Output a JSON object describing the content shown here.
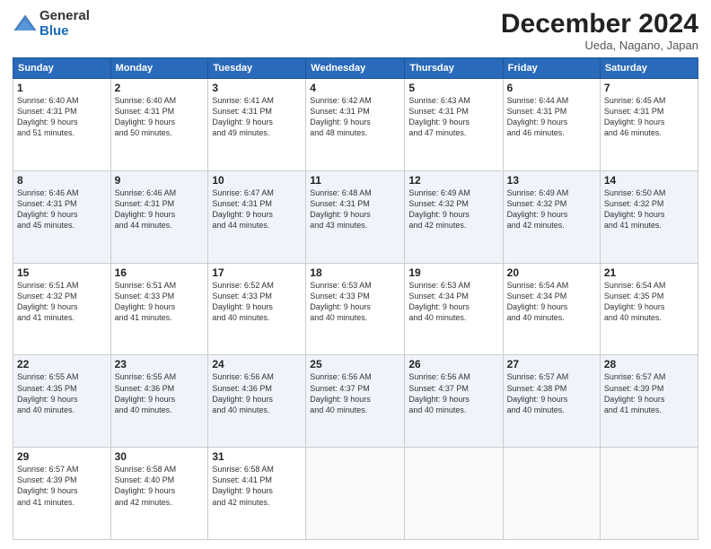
{
  "header": {
    "logo_general": "General",
    "logo_blue": "Blue",
    "title": "December 2024",
    "location": "Ueda, Nagano, Japan"
  },
  "weekdays": [
    "Sunday",
    "Monday",
    "Tuesday",
    "Wednesday",
    "Thursday",
    "Friday",
    "Saturday"
  ],
  "weeks": [
    [
      {
        "day": "1",
        "info": "Sunrise: 6:40 AM\nSunset: 4:31 PM\nDaylight: 9 hours\nand 51 minutes."
      },
      {
        "day": "2",
        "info": "Sunrise: 6:40 AM\nSunset: 4:31 PM\nDaylight: 9 hours\nand 50 minutes."
      },
      {
        "day": "3",
        "info": "Sunrise: 6:41 AM\nSunset: 4:31 PM\nDaylight: 9 hours\nand 49 minutes."
      },
      {
        "day": "4",
        "info": "Sunrise: 6:42 AM\nSunset: 4:31 PM\nDaylight: 9 hours\nand 48 minutes."
      },
      {
        "day": "5",
        "info": "Sunrise: 6:43 AM\nSunset: 4:31 PM\nDaylight: 9 hours\nand 47 minutes."
      },
      {
        "day": "6",
        "info": "Sunrise: 6:44 AM\nSunset: 4:31 PM\nDaylight: 9 hours\nand 46 minutes."
      },
      {
        "day": "7",
        "info": "Sunrise: 6:45 AM\nSunset: 4:31 PM\nDaylight: 9 hours\nand 46 minutes."
      }
    ],
    [
      {
        "day": "8",
        "info": "Sunrise: 6:46 AM\nSunset: 4:31 PM\nDaylight: 9 hours\nand 45 minutes."
      },
      {
        "day": "9",
        "info": "Sunrise: 6:46 AM\nSunset: 4:31 PM\nDaylight: 9 hours\nand 44 minutes."
      },
      {
        "day": "10",
        "info": "Sunrise: 6:47 AM\nSunset: 4:31 PM\nDaylight: 9 hours\nand 44 minutes."
      },
      {
        "day": "11",
        "info": "Sunrise: 6:48 AM\nSunset: 4:31 PM\nDaylight: 9 hours\nand 43 minutes."
      },
      {
        "day": "12",
        "info": "Sunrise: 6:49 AM\nSunset: 4:32 PM\nDaylight: 9 hours\nand 42 minutes."
      },
      {
        "day": "13",
        "info": "Sunrise: 6:49 AM\nSunset: 4:32 PM\nDaylight: 9 hours\nand 42 minutes."
      },
      {
        "day": "14",
        "info": "Sunrise: 6:50 AM\nSunset: 4:32 PM\nDaylight: 9 hours\nand 41 minutes."
      }
    ],
    [
      {
        "day": "15",
        "info": "Sunrise: 6:51 AM\nSunset: 4:32 PM\nDaylight: 9 hours\nand 41 minutes."
      },
      {
        "day": "16",
        "info": "Sunrise: 6:51 AM\nSunset: 4:33 PM\nDaylight: 9 hours\nand 41 minutes."
      },
      {
        "day": "17",
        "info": "Sunrise: 6:52 AM\nSunset: 4:33 PM\nDaylight: 9 hours\nand 40 minutes."
      },
      {
        "day": "18",
        "info": "Sunrise: 6:53 AM\nSunset: 4:33 PM\nDaylight: 9 hours\nand 40 minutes."
      },
      {
        "day": "19",
        "info": "Sunrise: 6:53 AM\nSunset: 4:34 PM\nDaylight: 9 hours\nand 40 minutes."
      },
      {
        "day": "20",
        "info": "Sunrise: 6:54 AM\nSunset: 4:34 PM\nDaylight: 9 hours\nand 40 minutes."
      },
      {
        "day": "21",
        "info": "Sunrise: 6:54 AM\nSunset: 4:35 PM\nDaylight: 9 hours\nand 40 minutes."
      }
    ],
    [
      {
        "day": "22",
        "info": "Sunrise: 6:55 AM\nSunset: 4:35 PM\nDaylight: 9 hours\nand 40 minutes."
      },
      {
        "day": "23",
        "info": "Sunrise: 6:55 AM\nSunset: 4:36 PM\nDaylight: 9 hours\nand 40 minutes."
      },
      {
        "day": "24",
        "info": "Sunrise: 6:56 AM\nSunset: 4:36 PM\nDaylight: 9 hours\nand 40 minutes."
      },
      {
        "day": "25",
        "info": "Sunrise: 6:56 AM\nSunset: 4:37 PM\nDaylight: 9 hours\nand 40 minutes."
      },
      {
        "day": "26",
        "info": "Sunrise: 6:56 AM\nSunset: 4:37 PM\nDaylight: 9 hours\nand 40 minutes."
      },
      {
        "day": "27",
        "info": "Sunrise: 6:57 AM\nSunset: 4:38 PM\nDaylight: 9 hours\nand 40 minutes."
      },
      {
        "day": "28",
        "info": "Sunrise: 6:57 AM\nSunset: 4:39 PM\nDaylight: 9 hours\nand 41 minutes."
      }
    ],
    [
      {
        "day": "29",
        "info": "Sunrise: 6:57 AM\nSunset: 4:39 PM\nDaylight: 9 hours\nand 41 minutes."
      },
      {
        "day": "30",
        "info": "Sunrise: 6:58 AM\nSunset: 4:40 PM\nDaylight: 9 hours\nand 42 minutes."
      },
      {
        "day": "31",
        "info": "Sunrise: 6:58 AM\nSunset: 4:41 PM\nDaylight: 9 hours\nand 42 minutes."
      },
      {
        "day": "",
        "info": ""
      },
      {
        "day": "",
        "info": ""
      },
      {
        "day": "",
        "info": ""
      },
      {
        "day": "",
        "info": ""
      }
    ]
  ]
}
